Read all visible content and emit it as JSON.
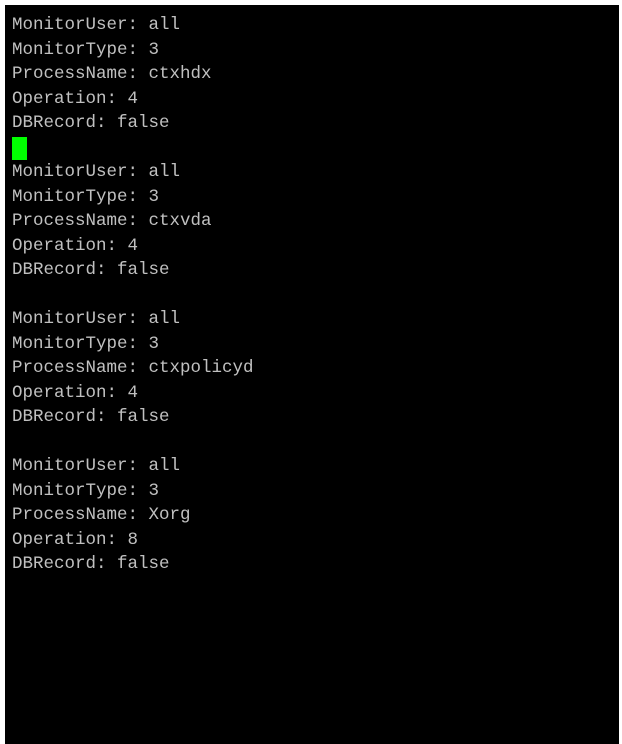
{
  "terminal": {
    "blocks": [
      {
        "lines": [
          "MonitorUser: all",
          "MonitorType: 3",
          "ProcessName: ctxhdx",
          "Operation: 4",
          "DBRecord: false"
        ]
      },
      {
        "lines": [
          "MonitorUser: all",
          "MonitorType: 3",
          "ProcessName: ctxvda",
          "Operation: 4",
          "DBRecord: false"
        ]
      },
      {
        "lines": [
          "MonitorUser: all",
          "MonitorType: 3",
          "ProcessName: ctxpolicyd",
          "Operation: 4",
          "DBRecord: false"
        ]
      },
      {
        "lines": [
          "MonitorUser: all",
          "MonitorType: 3",
          "ProcessName: Xorg",
          "Operation: 8",
          "DBRecord: false"
        ]
      }
    ],
    "colors": {
      "background": "#000000",
      "text": "#c0c0c0",
      "cursor": "#00ff00"
    }
  }
}
